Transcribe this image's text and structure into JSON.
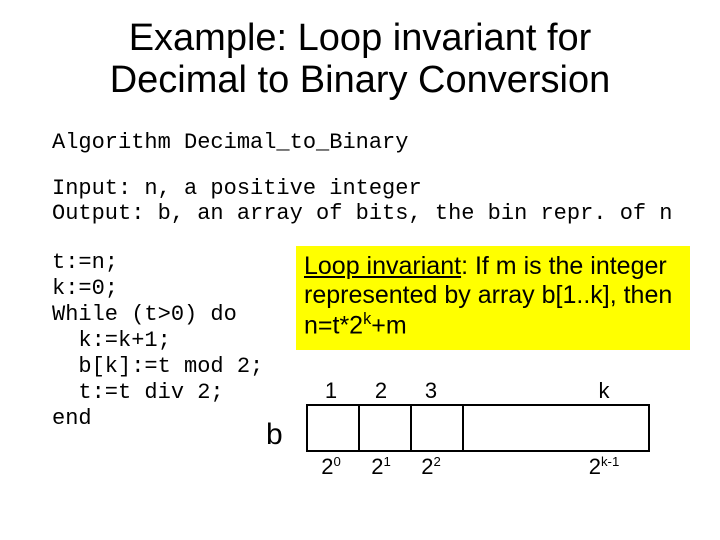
{
  "title_line1": "Example: Loop invariant for",
  "title_line2": "Decimal to Binary Conversion",
  "alg_name": "Algorithm Decimal_to_Binary",
  "input_line": "Input: n, a positive integer",
  "output_line": "Output: b, an array of bits, the bin repr. of n",
  "code_lines": [
    "t:=n;",
    "k:=0;",
    "While (t>0) do",
    "  k:=k+1;",
    "  b[k]:=t mod 2;",
    "  t:=t div 2;",
    "end"
  ],
  "invariant": {
    "label": "Loop invariant",
    "text_part1": ": If m is the integer represented by array b[1..k], then n=t*2",
    "sup": "k",
    "text_part2": "+m"
  },
  "diagram": {
    "array_label": "b",
    "top_indices": [
      "1",
      "2",
      "3",
      "",
      "k"
    ],
    "bottom_bases": [
      "2",
      "2",
      "2",
      "",
      "2"
    ],
    "bottom_exponents": [
      "0",
      "1",
      "2",
      "",
      "k-1"
    ]
  }
}
